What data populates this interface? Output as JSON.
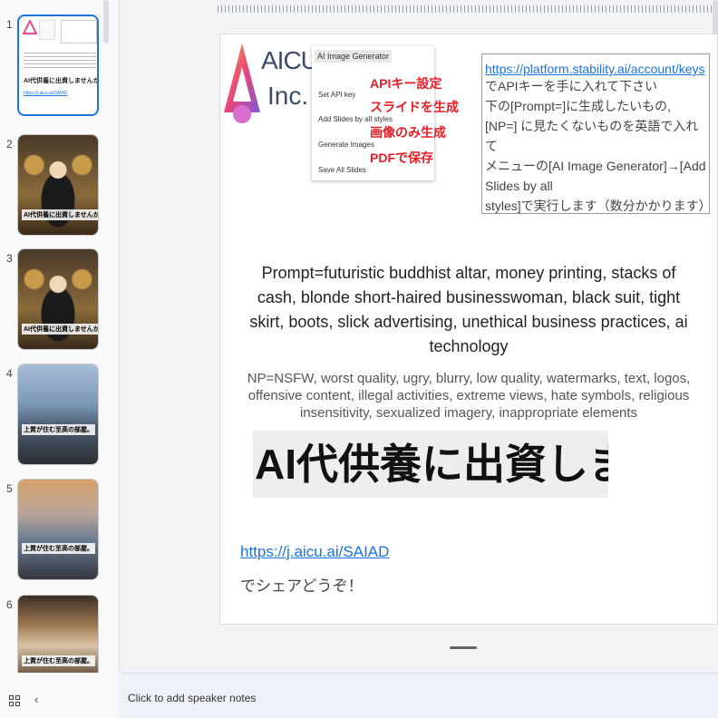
{
  "filmstrip": {
    "slides": [
      {
        "number": "1",
        "caption": "AI代供養に出資しませんか？",
        "mini_link": "https://j.aicu.ai/SAIAD"
      },
      {
        "number": "2",
        "caption": "AI代供養に出資しませんか？"
      },
      {
        "number": "3",
        "caption": "AI代供養に出資しませんか？"
      },
      {
        "number": "4",
        "caption": "上質が住む至高の部屋。"
      },
      {
        "number": "5",
        "caption": "上質が住む至高の部屋。"
      },
      {
        "number": "6",
        "caption": "上質が住む至高の部屋。"
      }
    ]
  },
  "slide": {
    "logo_text_1": "AICU",
    "logo_text_2": "Inc.",
    "menu": {
      "title": "AI Image Generator",
      "items": [
        "Set API key",
        "Add Slides by all styles",
        "Generate Images",
        "Save All Slides"
      ],
      "callouts": [
        "APIキー設定",
        "スライドを生成",
        "画像のみ生成",
        "PDFで保存"
      ]
    },
    "info": {
      "link": "https://platform.stability.ai/account/keys",
      "lines": [
        "でAPIキーを手に入れて下さい",
        "下の[Prompt=]に生成したいもの,",
        "[NP=] に見たくないものを英語で入れて",
        "メニューの[AI Image Generator]→[Add Slides by all",
        "styles]で実行します（数分かかります）"
      ]
    },
    "prompt": "Prompt=futuristic buddhist altar, money printing, stacks of cash, blonde short-haired businesswoman, black suit, tight skirt, boots, slick advertising, unethical business practices, ai technology",
    "np": "NP=NSFW, worst quality, ugry, blurry, low quality, watermarks, text, logos, offensive content, illegal activities, extreme views, hate symbols, religious insensitivity, sexualized imagery, inappropriate elements",
    "title": "AI代供養に出資しませんか？",
    "share_link": "https://j.aicu.ai/SAIAD",
    "share_text": "でシェアどうぞ！"
  },
  "notes": {
    "placeholder": "Click to add speaker notes"
  },
  "icons": {
    "grid": "grid-view-icon",
    "collapse": "chevron-left-icon"
  }
}
